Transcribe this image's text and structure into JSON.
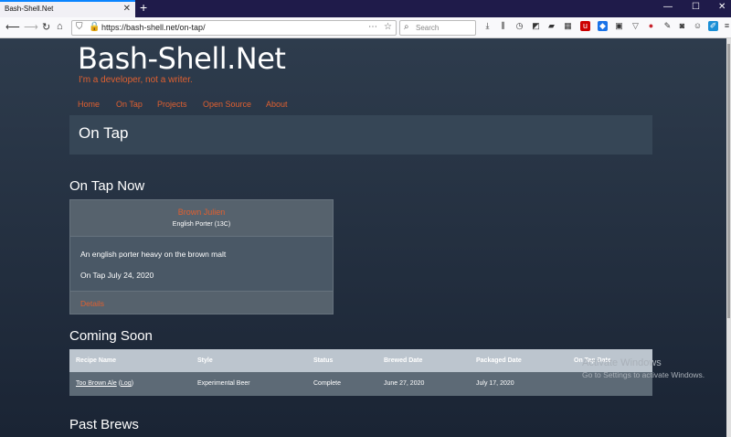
{
  "browser": {
    "tab_title": "Bash-Shell.Net",
    "tab_close": "✕",
    "new_tab": "+",
    "url": "https://bash-shell.net/on-tap/",
    "search_placeholder": "Search",
    "win_min": "—",
    "win_max": "☐",
    "win_close": "✕",
    "toolbar_icons": [
      "download-icon",
      "library-icon",
      "history-icon",
      "extension-icon-1",
      "extension-icon-2",
      "extension-icon-3",
      "extension-icon-4",
      "extension-icon-5",
      "extension-icon-6",
      "extension-icon-7",
      "extension-icon-8",
      "extension-icon-9",
      "extension-icon-10",
      "account-icon",
      "menu-icon"
    ]
  },
  "site": {
    "title": "Bash-Shell.Net",
    "tagline": "I'm a developer, not a writer.",
    "nav": [
      "Home",
      "On Tap",
      "Projects",
      "Open Source",
      "About"
    ],
    "page_title": "On Tap"
  },
  "on_tap_now": {
    "heading": "On Tap Now",
    "beer_name": "Brown Julien",
    "beer_style": "English Porter (13C)",
    "description": "An english porter heavy on the brown malt",
    "on_tap_date": "On Tap July 24, 2020",
    "details_link": "Details"
  },
  "coming_soon": {
    "heading": "Coming Soon",
    "columns": [
      "Recipe Name",
      "Style",
      "Status",
      "Brewed Date",
      "Packaged Date",
      "On Tap Date"
    ],
    "rows": [
      {
        "recipe": "Too Brown Ale",
        "log": "Log",
        "style": "Experimental Beer",
        "status": "Complete",
        "brewed": "June 27, 2020",
        "packaged": "July 17, 2020",
        "on_tap": ""
      }
    ]
  },
  "past_brews": {
    "heading": "Past Brews"
  },
  "watermark": {
    "line1": "Activate Windows",
    "line2": "Go to Settings to activate Windows."
  },
  "colors": {
    "accent": "#e06030",
    "page_bg": "#2e3c4d",
    "browser_frame": "#1f1b4a"
  }
}
